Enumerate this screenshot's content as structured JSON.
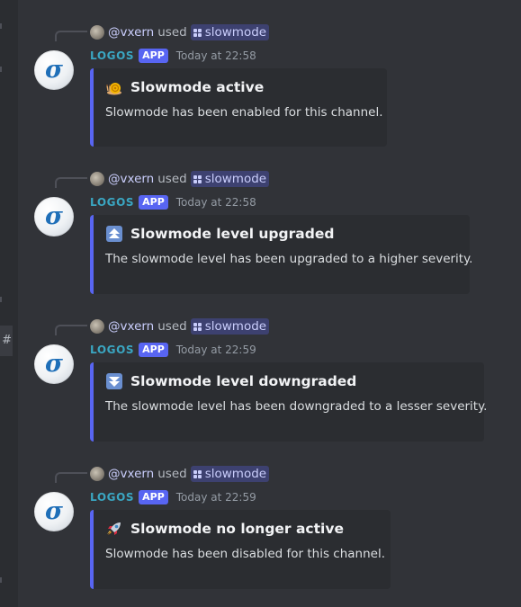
{
  "messages": [
    {
      "reply": {
        "mention": "@vxern",
        "used": "used",
        "command": "slowmode"
      },
      "author": {
        "name": "LOGOS",
        "badge": "APP",
        "avatar_letter": "σ"
      },
      "timestamp": "Today at 22:58",
      "embed": {
        "icon": "snail-icon",
        "title": "Slowmode active",
        "description": "Slowmode has been enabled for this channel."
      }
    },
    {
      "reply": {
        "mention": "@vxern",
        "used": "used",
        "command": "slowmode"
      },
      "author": {
        "name": "LOGOS",
        "badge": "APP",
        "avatar_letter": "σ"
      },
      "timestamp": "Today at 22:58",
      "embed": {
        "icon": "double-up-arrow-icon",
        "title": "Slowmode level upgraded",
        "description": "The slowmode level has been upgraded to a higher severity."
      }
    },
    {
      "reply": {
        "mention": "@vxern",
        "used": "used",
        "command": "slowmode"
      },
      "author": {
        "name": "LOGOS",
        "badge": "APP",
        "avatar_letter": "σ"
      },
      "timestamp": "Today at 22:59",
      "embed": {
        "icon": "double-down-arrow-icon",
        "title": "Slowmode level downgraded",
        "description": "The slowmode level has been downgraded to a lesser severity."
      }
    },
    {
      "reply": {
        "mention": "@vxern",
        "used": "used",
        "command": "slowmode"
      },
      "author": {
        "name": "LOGOS",
        "badge": "APP",
        "avatar_letter": "σ"
      },
      "timestamp": "Today at 22:59",
      "embed": {
        "icon": "rocket-icon",
        "title": "Slowmode no longer active",
        "description": "Slowmode has been disabled for this channel."
      }
    }
  ],
  "gutter": {
    "channel_mark": "#"
  },
  "colors": {
    "background": "#313338",
    "embed_bg": "#2b2d31",
    "embed_border": "#5865f2",
    "username": "#3aa6c2",
    "app_badge": "#5865f2"
  }
}
